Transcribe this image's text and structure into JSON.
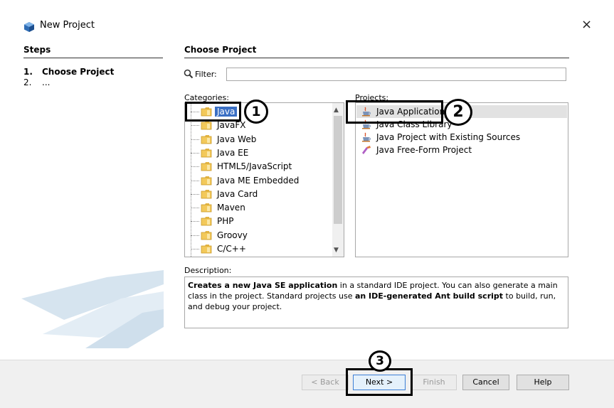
{
  "window": {
    "title": "New Project",
    "close_glyph": "×",
    "app_icon": "netbeans-cube-icon"
  },
  "steps": {
    "heading": "Steps",
    "items": [
      {
        "num": "1.",
        "label": "Choose Project"
      },
      {
        "num": "2.",
        "label": "..."
      }
    ]
  },
  "main": {
    "heading": "Choose Project",
    "filter": {
      "label": "Filter:",
      "value": ""
    },
    "categories": {
      "label": "Categories:",
      "selected": "Java",
      "items": [
        "Java",
        "JavaFX",
        "Java Web",
        "Java EE",
        "HTML5/JavaScript",
        "Java ME Embedded",
        "Java Card",
        "Maven",
        "PHP",
        "Groovy",
        "C/C++"
      ]
    },
    "projects": {
      "label": "Projects:",
      "selected": "Java Application",
      "items": [
        {
          "label": "Java Application",
          "icon": "java-cup-icon"
        },
        {
          "label": "Java Class Library",
          "icon": "java-cup-icon"
        },
        {
          "label": "Java Project with Existing Sources",
          "icon": "java-cup-icon"
        },
        {
          "label": "Java Free-Form Project",
          "icon": "java-freeform-icon"
        }
      ]
    },
    "description": {
      "label": "Description:",
      "parts": [
        {
          "text": "Creates a new Java SE application",
          "bold": true
        },
        {
          "text": " in a standard IDE project. You can also generate a main class in the project. Standard projects use ",
          "bold": false
        },
        {
          "text": "an IDE-generated Ant build script",
          "bold": true
        },
        {
          "text": " to build, run, and debug your project.",
          "bold": false
        }
      ]
    }
  },
  "buttons": {
    "back": "< Back",
    "next": "Next >",
    "finish": "Finish",
    "cancel": "Cancel",
    "help": "Help"
  },
  "annotations": {
    "one": "1",
    "two": "2",
    "three": "3"
  }
}
